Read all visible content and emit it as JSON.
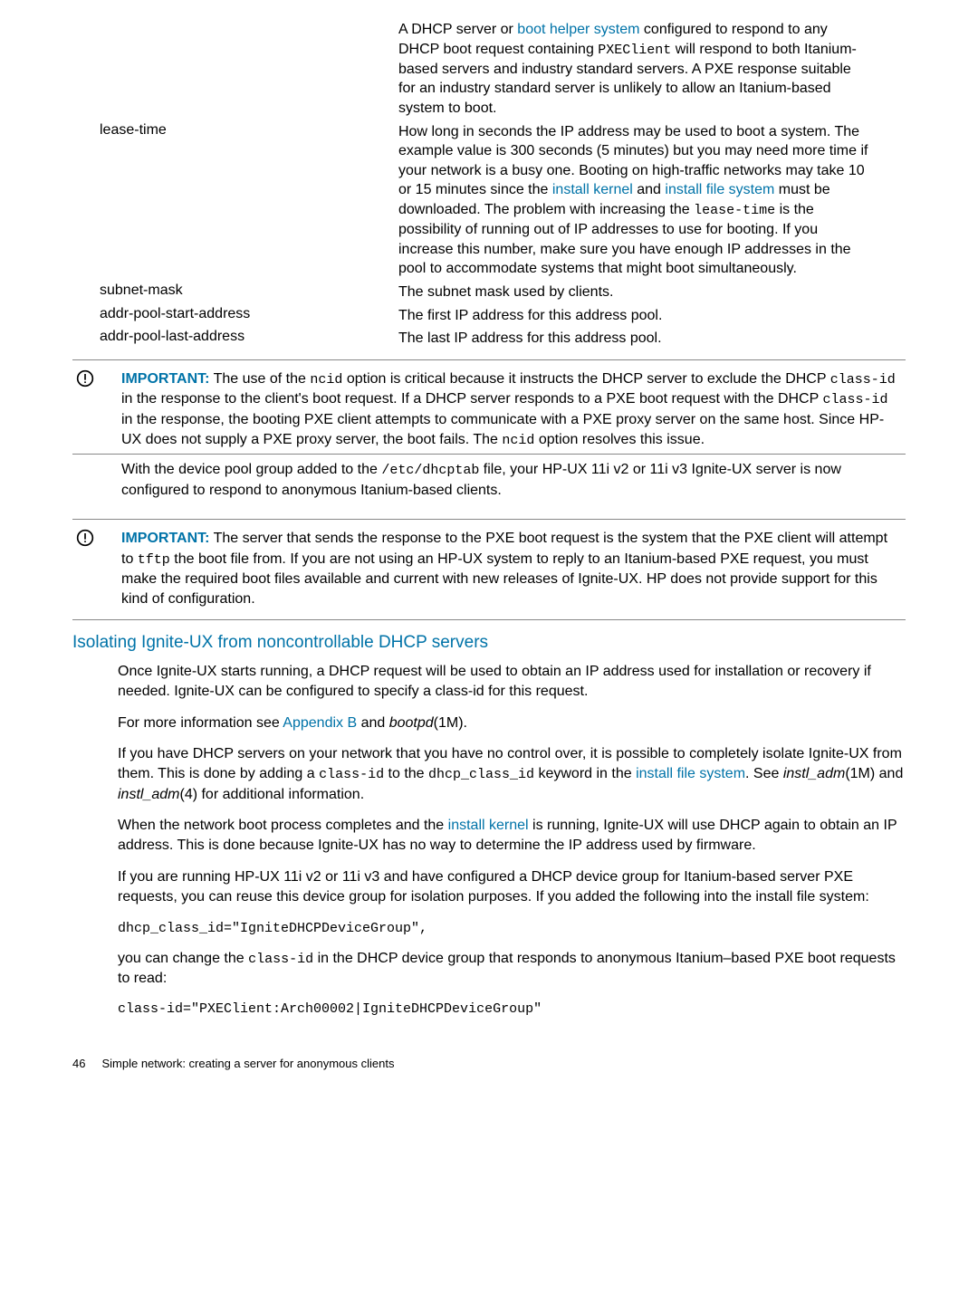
{
  "definitions": {
    "row0_desc_a": "A DHCP server or ",
    "row0_link": "boot helper system",
    "row0_desc_b": " configured to respond to any DHCP boot request containing ",
    "row0_code": "PXEClient",
    "row0_desc_c": " will respond to both Itanium-based servers and industry standard servers. A PXE response suitable for an industry standard server is unlikely to allow an Itanium-based system to boot.",
    "row1_term": "lease-time",
    "row1_a": "How long in seconds the IP address may be used to boot a system. The example value is 300 seconds (5 minutes) but you may need more time if your network is a busy one. Booting on high-traffic networks may take 10 or 15 minutes since the ",
    "row1_link1": "install kernel",
    "row1_mid": " and ",
    "row1_link2": "install file system",
    "row1_b": " must be downloaded. The problem with increasing the ",
    "row1_code": "lease-time",
    "row1_c": " is the possibility of running out of IP addresses to use for booting. If you increase this number, make sure you have enough IP addresses in the pool to accommodate systems that might boot simultaneously.",
    "row2_term": "subnet-mask",
    "row2_desc": "The subnet mask used by clients.",
    "row3_term": "addr-pool-start-address",
    "row3_desc": "The first IP address for this address pool.",
    "row4_term": "addr-pool-last-address",
    "row4_desc": "The last IP address for this address pool."
  },
  "important1": {
    "label": "IMPORTANT:",
    "a": "   The use of the ",
    "code1": "ncid",
    "b": " option is critical because it instructs the DHCP server to exclude the DHCP ",
    "code2": "class-id",
    "c": " in the response to the client's boot request. If a DHCP server responds to a PXE boot request with the DHCP ",
    "code3": "class-id",
    "d": " in the response, the booting PXE client attempts to communicate with a PXE proxy server on the same host. Since HP-UX does not supply a PXE proxy server, the boot fails. The ",
    "code4": "ncid",
    "e": " option resolves this issue."
  },
  "mid_para": {
    "a": "With the device pool group added to the ",
    "code": "/etc/dhcptab",
    "b": " file, your HP-UX 11i v2 or 11i v3 Ignite-UX server is now configured to respond to anonymous Itanium-based clients."
  },
  "important2": {
    "label": "IMPORTANT:",
    "a": "   The server that sends the response to the PXE boot request is the system that the PXE client will attempt to ",
    "code1": "tftp",
    "b": " the boot file from. If you are not using an HP-UX system to reply to an Itanium-based PXE request, you must make the required boot files available and current with new releases of Ignite-UX. HP does not provide support for this kind of configuration."
  },
  "section_heading": "Isolating Ignite-UX from noncontrollable DHCP servers",
  "body": {
    "p1": "Once Ignite-UX starts running, a DHCP request will be used to obtain an IP address used for installation or recovery if needed. Ignite-UX can be configured to specify a class-id for this request.",
    "p2a": "For more information see ",
    "p2link": "Appendix B",
    "p2b": " and ",
    "p2i": "bootpd",
    "p2c": "(1M).",
    "p3a": "If you have DHCP servers on your network that you have no control over, it is possible to completely isolate Ignite-UX from them. This is done by adding a ",
    "p3code1": "class-id",
    "p3b": " to the ",
    "p3code2": "dhcp_class_id",
    "p3c": " keyword in the ",
    "p3link": "install file system",
    "p3d": ". See ",
    "p3i1": "instl_adm",
    "p3e": "(1M) and ",
    "p3i2": "instl_adm",
    "p3f": "(4) for additional information.",
    "p4a": "When the network boot process completes and the ",
    "p4link": "install kernel",
    "p4b": " is running, Ignite-UX will use DHCP again to obtain an IP address. This is done because Ignite-UX has no way to determine the IP address used by firmware.",
    "p5": "If you are running HP-UX 11i v2 or 11i v3 and have configured a DHCP device group for Itanium-based server PXE requests, you can reuse this device group for isolation purposes. If you added the following into the install file system:",
    "code1": "dhcp_class_id=\"IgniteDHCPDeviceGroup\",",
    "p6a": "you can change the ",
    "p6code": "class-id",
    "p6b": " in the DHCP device group that responds to anonymous Itanium–based PXE boot requests to read:",
    "code2": "class-id=\"PXEClient:Arch00002|IgniteDHCPDeviceGroup\""
  },
  "footer": {
    "page": "46",
    "title": "Simple network: creating a server for anonymous clients"
  }
}
